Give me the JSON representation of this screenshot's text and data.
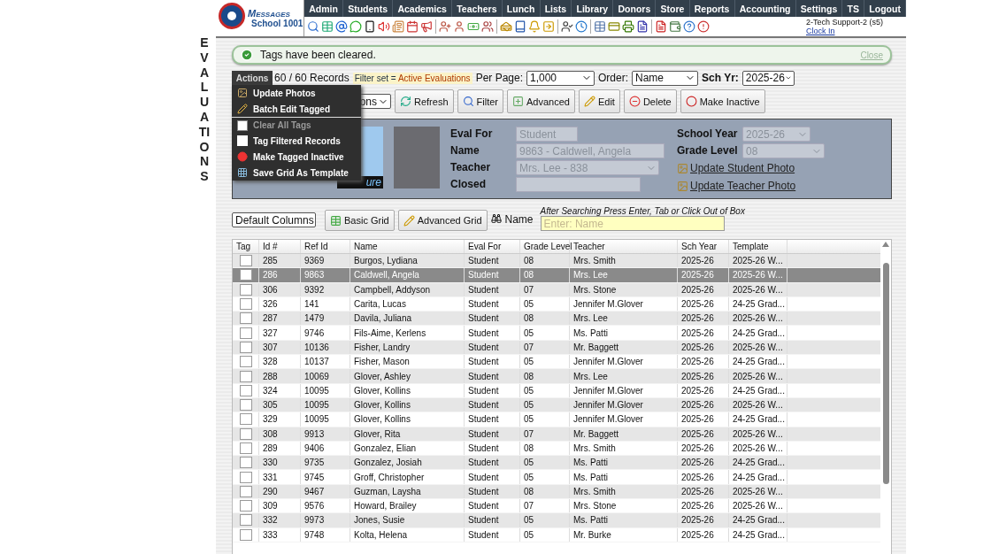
{
  "side_title": "EVALUATIONS",
  "logo": {
    "brand": "Messages",
    "school": "School 1001"
  },
  "nav": [
    "Admin",
    "Students",
    "Academics",
    "Teachers",
    "Lunch",
    "Lists",
    "Library",
    "Donors",
    "Store",
    "Reports",
    "Accounting",
    "Settings",
    "TS",
    "Logout"
  ],
  "user": {
    "name": "2-Tech Support-2 (s5)",
    "link": "Clock In"
  },
  "notice": {
    "text": "Tags have been cleared.",
    "close": "Close"
  },
  "records": {
    "count": "60 / 60 Records",
    "filter_label": "Filter set = ",
    "filter_value": "Active Evaluations",
    "per_page_label": "Per Page:",
    "per_page": "1,000",
    "order_label": "Order:",
    "order": "Name",
    "year_label": "Sch Yr:",
    "year": "2025-26"
  },
  "actions_select": "ons",
  "buttons": [
    {
      "kind": "refresh",
      "label": "Refresh"
    },
    {
      "kind": "filter",
      "label": "Filter"
    },
    {
      "kind": "advanced",
      "label": "Advanced"
    },
    {
      "kind": "edit",
      "label": "Edit"
    },
    {
      "kind": "delete",
      "label": "Delete"
    },
    {
      "kind": "inactive",
      "label": "Make Inactive"
    }
  ],
  "menu": {
    "title": "Actions",
    "items": [
      {
        "kind": "photo",
        "label": "Update Photos",
        "disabled": false
      },
      {
        "kind": "pencil",
        "label": "Batch Edit Tagged",
        "disabled": false
      },
      {
        "kind": "box",
        "label": "Clear All Tags",
        "disabled": true
      },
      {
        "kind": "check",
        "label": "Tag Filtered Records",
        "disabled": false
      },
      {
        "kind": "dot",
        "label": "Make Tagged Inactive",
        "disabled": false
      },
      {
        "kind": "grid",
        "label": "Save Grid As Template",
        "disabled": false
      }
    ]
  },
  "detail": {
    "photo_caption": "ure",
    "eval_for_label": "Eval For",
    "eval_for": "Student",
    "name_label": "Name",
    "name": "9863 - Caldwell, Angela",
    "teacher_label": "Teacher",
    "teacher": "Mrs. Lee - 838",
    "closed_label": "Closed",
    "school_year_label": "School Year",
    "school_year": "2025-26",
    "grade_label": "Grade Level",
    "grade": "08",
    "update_student": " Update Student Photo",
    "update_teacher": " Update Teacher Photo"
  },
  "grid_bar": {
    "columns_select": "Default Columns",
    "basic": "Basic Grid",
    "advanced": "Advanced Grid",
    "search_label": "Name",
    "hint": "After Searching Press Enter, Tab or Click Out of Box",
    "placeholder": "Enter: Name"
  },
  "table": {
    "tag_column": "Tag",
    "columns": [
      "Id #",
      "Ref Id",
      "Name",
      "Eval For",
      "Grade Level",
      "Teacher",
      "Sch Year",
      "Template"
    ],
    "rows": [
      {
        "selected": false,
        "tagged": false,
        "cells": [
          "285",
          "9369",
          "Burgos, Lydiana",
          "Student",
          "08",
          "Mrs. Smith",
          "2025-26",
          "2025-26 W..."
        ]
      },
      {
        "selected": true,
        "tagged": false,
        "cells": [
          "286",
          "9863",
          "Caldwell, Angela",
          "Student",
          "08",
          "Mrs. Lee",
          "2025-26",
          "2025-26 W..."
        ]
      },
      {
        "selected": false,
        "tagged": false,
        "cells": [
          "306",
          "9392",
          "Campbell, Addyson",
          "Student",
          "07",
          "Mrs. Stone",
          "2025-26",
          "2025-26 W..."
        ]
      },
      {
        "selected": false,
        "tagged": false,
        "cells": [
          "326",
          "141",
          "Carita, Lucas",
          "Student",
          "05",
          "Jennifer M.Glover",
          "2025-26",
          "24-25 Grad..."
        ]
      },
      {
        "selected": false,
        "tagged": false,
        "cells": [
          "287",
          "1479",
          "Davila, Juliana",
          "Student",
          "08",
          "Mrs. Lee",
          "2025-26",
          "2025-26 W..."
        ]
      },
      {
        "selected": false,
        "tagged": false,
        "cells": [
          "327",
          "9746",
          "Fils-Aime, Kerlens",
          "Student",
          "05",
          "Ms. Patti",
          "2025-26",
          "24-25 Grad..."
        ]
      },
      {
        "selected": false,
        "tagged": false,
        "cells": [
          "307",
          "10136",
          "Fisher, Landry",
          "Student",
          "07",
          "Mr. Baggett",
          "2025-26",
          "2025-26 W..."
        ]
      },
      {
        "selected": false,
        "tagged": false,
        "cells": [
          "328",
          "10137",
          "Fisher, Mason",
          "Student",
          "05",
          "Jennifer M.Glover",
          "2025-26",
          "24-25 Grad..."
        ]
      },
      {
        "selected": false,
        "tagged": false,
        "cells": [
          "288",
          "10069",
          "Glover, Ashley",
          "Student",
          "08",
          "Mrs. Lee",
          "2025-26",
          "2025-26 W..."
        ]
      },
      {
        "selected": false,
        "tagged": false,
        "cells": [
          "324",
          "10095",
          "Glover, Kollins",
          "Student",
          "05",
          "Jennifer M.Glover",
          "2025-26",
          "24-25 Grad..."
        ]
      },
      {
        "selected": false,
        "tagged": false,
        "cells": [
          "305",
          "10095",
          "Glover, Kollins",
          "Student",
          "05",
          "Jennifer M.Glover",
          "2025-26",
          "2025-26 W..."
        ]
      },
      {
        "selected": false,
        "tagged": false,
        "cells": [
          "329",
          "10095",
          "Glover, Kollins",
          "Student",
          "05",
          "Jennifer M.Glover",
          "2025-26",
          "24-25 Grad..."
        ]
      },
      {
        "selected": false,
        "tagged": false,
        "cells": [
          "308",
          "9913",
          "Glover, Rita",
          "Student",
          "07",
          "Mr. Baggett",
          "2025-26",
          "2025-26 W..."
        ]
      },
      {
        "selected": false,
        "tagged": false,
        "cells": [
          "289",
          "9406",
          "Gonzalez, Elian",
          "Student",
          "08",
          "Mrs. Smith",
          "2025-26",
          "2025-26 W..."
        ]
      },
      {
        "selected": false,
        "tagged": false,
        "cells": [
          "330",
          "9735",
          "Gonzalez, Josiah",
          "Student",
          "05",
          "Ms. Patti",
          "2025-26",
          "24-25 Grad..."
        ]
      },
      {
        "selected": false,
        "tagged": false,
        "cells": [
          "331",
          "9745",
          "Groff, Christopher",
          "Student",
          "05",
          "Ms. Patti",
          "2025-26",
          "24-25 Grad..."
        ]
      },
      {
        "selected": false,
        "tagged": false,
        "cells": [
          "290",
          "9467",
          "Guzman, Laysha",
          "Student",
          "08",
          "Mrs. Smith",
          "2025-26",
          "2025-26 W..."
        ]
      },
      {
        "selected": false,
        "tagged": false,
        "cells": [
          "309",
          "9576",
          "Howard, Brailey",
          "Student",
          "07",
          "Mrs. Stone",
          "2025-26",
          "2025-26 W..."
        ]
      },
      {
        "selected": false,
        "tagged": false,
        "cells": [
          "332",
          "9973",
          "Jones, Susie",
          "Student",
          "05",
          "Ms. Patti",
          "2025-26",
          "24-25 Grad..."
        ]
      },
      {
        "selected": false,
        "tagged": false,
        "cells": [
          "333",
          "9748",
          "Kolta, Helena",
          "Student",
          "05",
          "Mr. Burke",
          "2025-26",
          "24-25 Grad..."
        ]
      }
    ]
  }
}
